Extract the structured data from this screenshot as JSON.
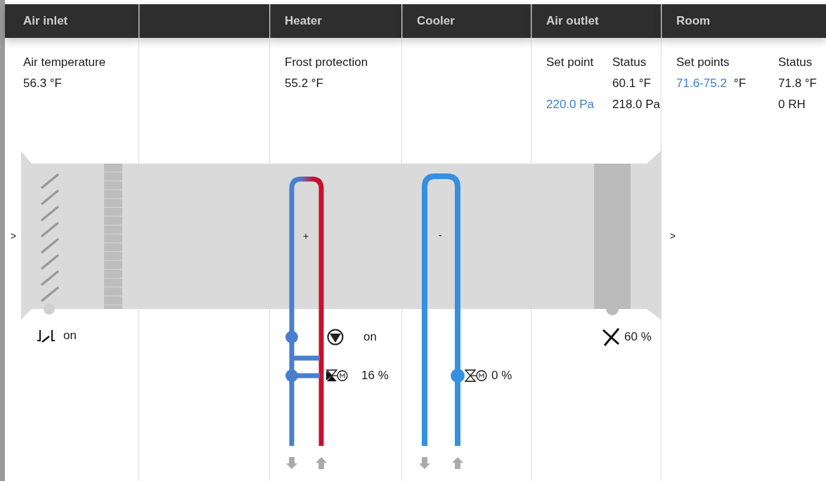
{
  "columns": [
    {
      "kind": "reading",
      "header": "Air inlet",
      "label": "Air temperature",
      "value": "56.3 °F"
    },
    {
      "kind": "empty"
    },
    {
      "kind": "reading",
      "header": "Heater",
      "label": "Frost protection",
      "value": "55.2 °F"
    },
    {
      "kind": "empty",
      "header": "Cooler"
    },
    {
      "kind": "outlet",
      "header": "Air outlet",
      "setpoint_label": "Set point",
      "status_label": "Status",
      "status_temperature": "60.1 °F",
      "setpoint_pressure": "220.0 Pa",
      "status_pressure": "218.0 Pa"
    },
    {
      "kind": "room",
      "header": "Room",
      "setpoints_label": "Set points",
      "setpoints_range": "71.6-75.2",
      "setpoints_unit": "°F",
      "status_label": "Status",
      "status_temperature": "71.8 °F",
      "status_humidity": "0 RH"
    }
  ],
  "schematic": {
    "inlet_arrow": ">",
    "outlet_arrow": ">",
    "damper": {
      "state": "on"
    },
    "heater": {
      "sign": "+",
      "pump": "on",
      "valve": "16 %"
    },
    "cooler": {
      "sign": "-",
      "valve": "0 %"
    },
    "fan": {
      "reading": "60 %"
    }
  }
}
